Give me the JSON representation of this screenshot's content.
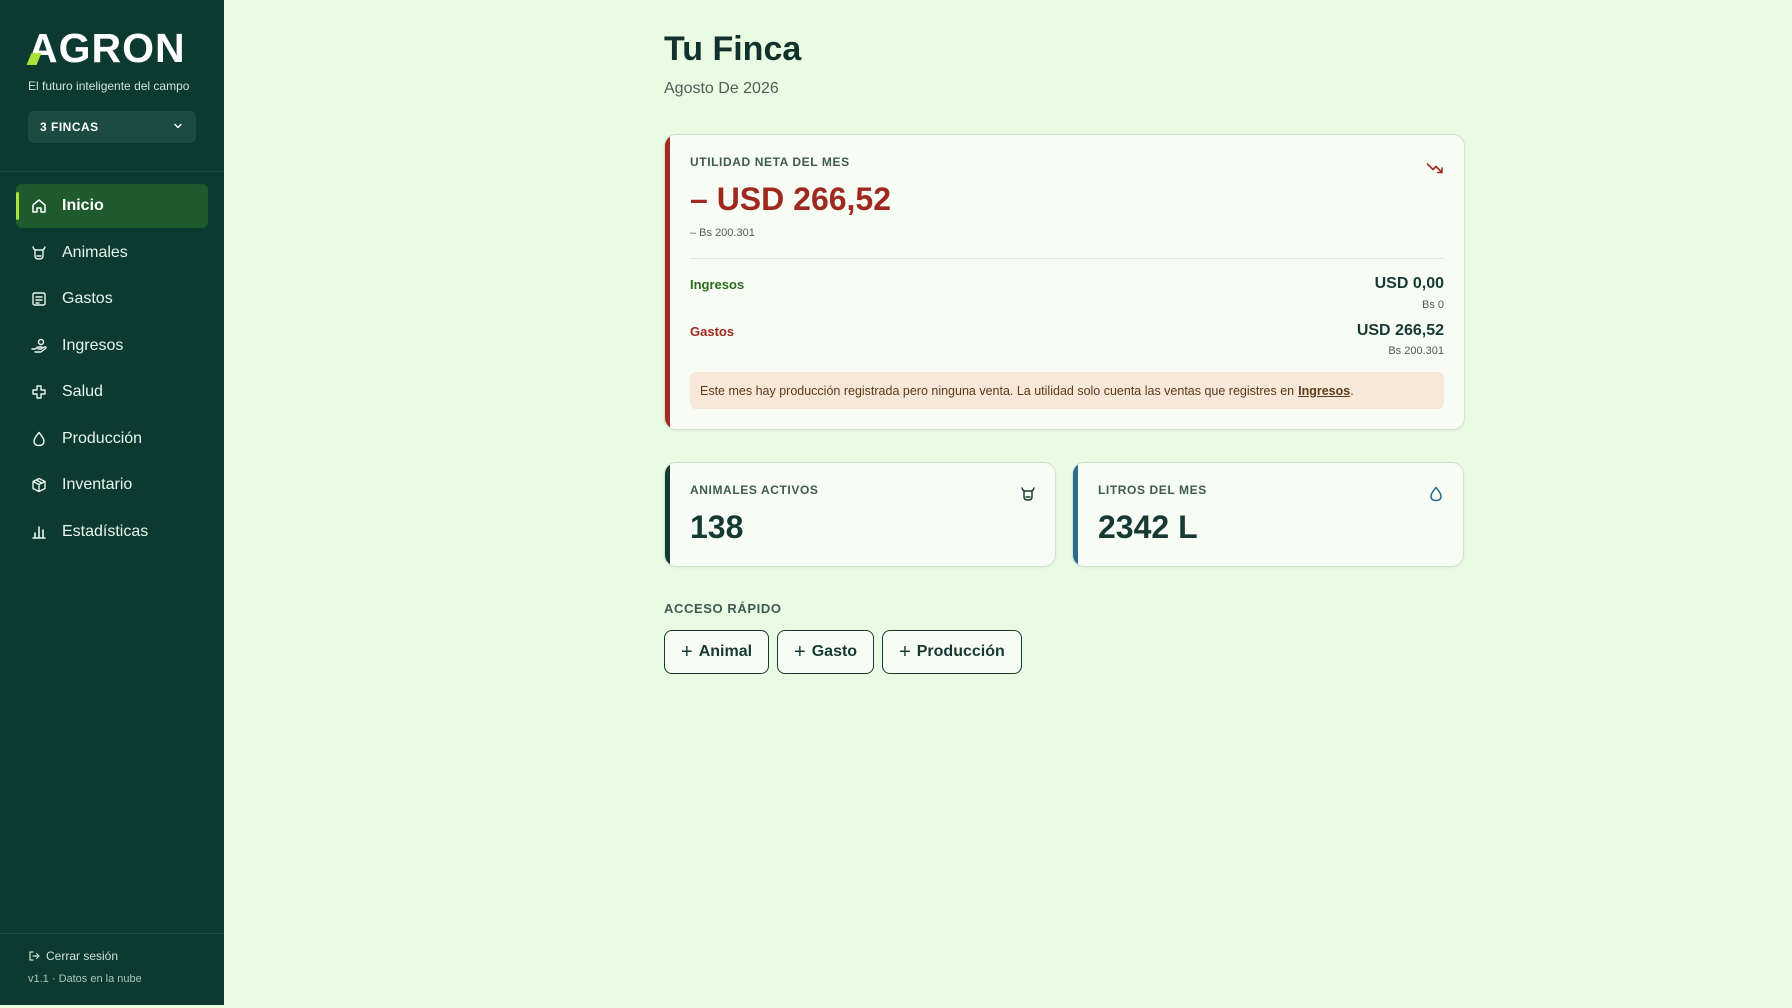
{
  "brand": {
    "logo_rest": "GRON",
    "logo_first": "A",
    "tagline": "El futuro inteligente del campo"
  },
  "farm_selector": {
    "label": "3 FINCAS"
  },
  "sidebar": {
    "items": [
      {
        "label": "Inicio",
        "icon": "home-icon",
        "active": true
      },
      {
        "label": "Animales",
        "icon": "cow-icon",
        "active": false
      },
      {
        "label": "Gastos",
        "icon": "receipt-icon",
        "active": false
      },
      {
        "label": "Ingresos",
        "icon": "hand-coins-icon",
        "active": false
      },
      {
        "label": "Salud",
        "icon": "health-cross-icon",
        "active": false
      },
      {
        "label": "Producción",
        "icon": "droplet-icon",
        "active": false
      },
      {
        "label": "Inventario",
        "icon": "package-icon",
        "active": false
      },
      {
        "label": "Estadísticas",
        "icon": "bar-chart-icon",
        "active": false
      }
    ],
    "logout_label": "Cerrar sesión",
    "version": "v1.1 · Datos en la nube"
  },
  "header": {
    "title": "Tu Finca",
    "subtitle": "Agosto De 2026"
  },
  "net_profit": {
    "label": "UTILIDAD NETA DEL MES",
    "value": "– USD 266,52",
    "value_bs": "– Bs 200.301",
    "income_label": "Ingresos",
    "income_usd": "USD 0,00",
    "income_bs": "Bs 0",
    "expense_label": "Gastos",
    "expense_usd": "USD 266,52",
    "expense_bs": "Bs 200.301",
    "notice_text": "Este mes hay producción registrada pero ninguna venta. La utilidad solo cuenta las ventas que registres en",
    "notice_link": "Ingresos",
    "notice_end": "."
  },
  "stats": {
    "animals_label": "ANIMALES ACTIVOS",
    "animals_value": "138",
    "liters_label": "LITROS DEL MES",
    "liters_value": "2342 L"
  },
  "quick_access": {
    "label": "ACCESO RÁPIDO",
    "buttons": [
      "Animal",
      "Gasto",
      "Producción"
    ]
  },
  "colors": {
    "sidebar_bg": "#0c3a30",
    "page_bg": "#eafbe3",
    "accent_lime": "#a9e23b",
    "negative_red": "#a0291f",
    "income_green": "#2c6b1e"
  }
}
